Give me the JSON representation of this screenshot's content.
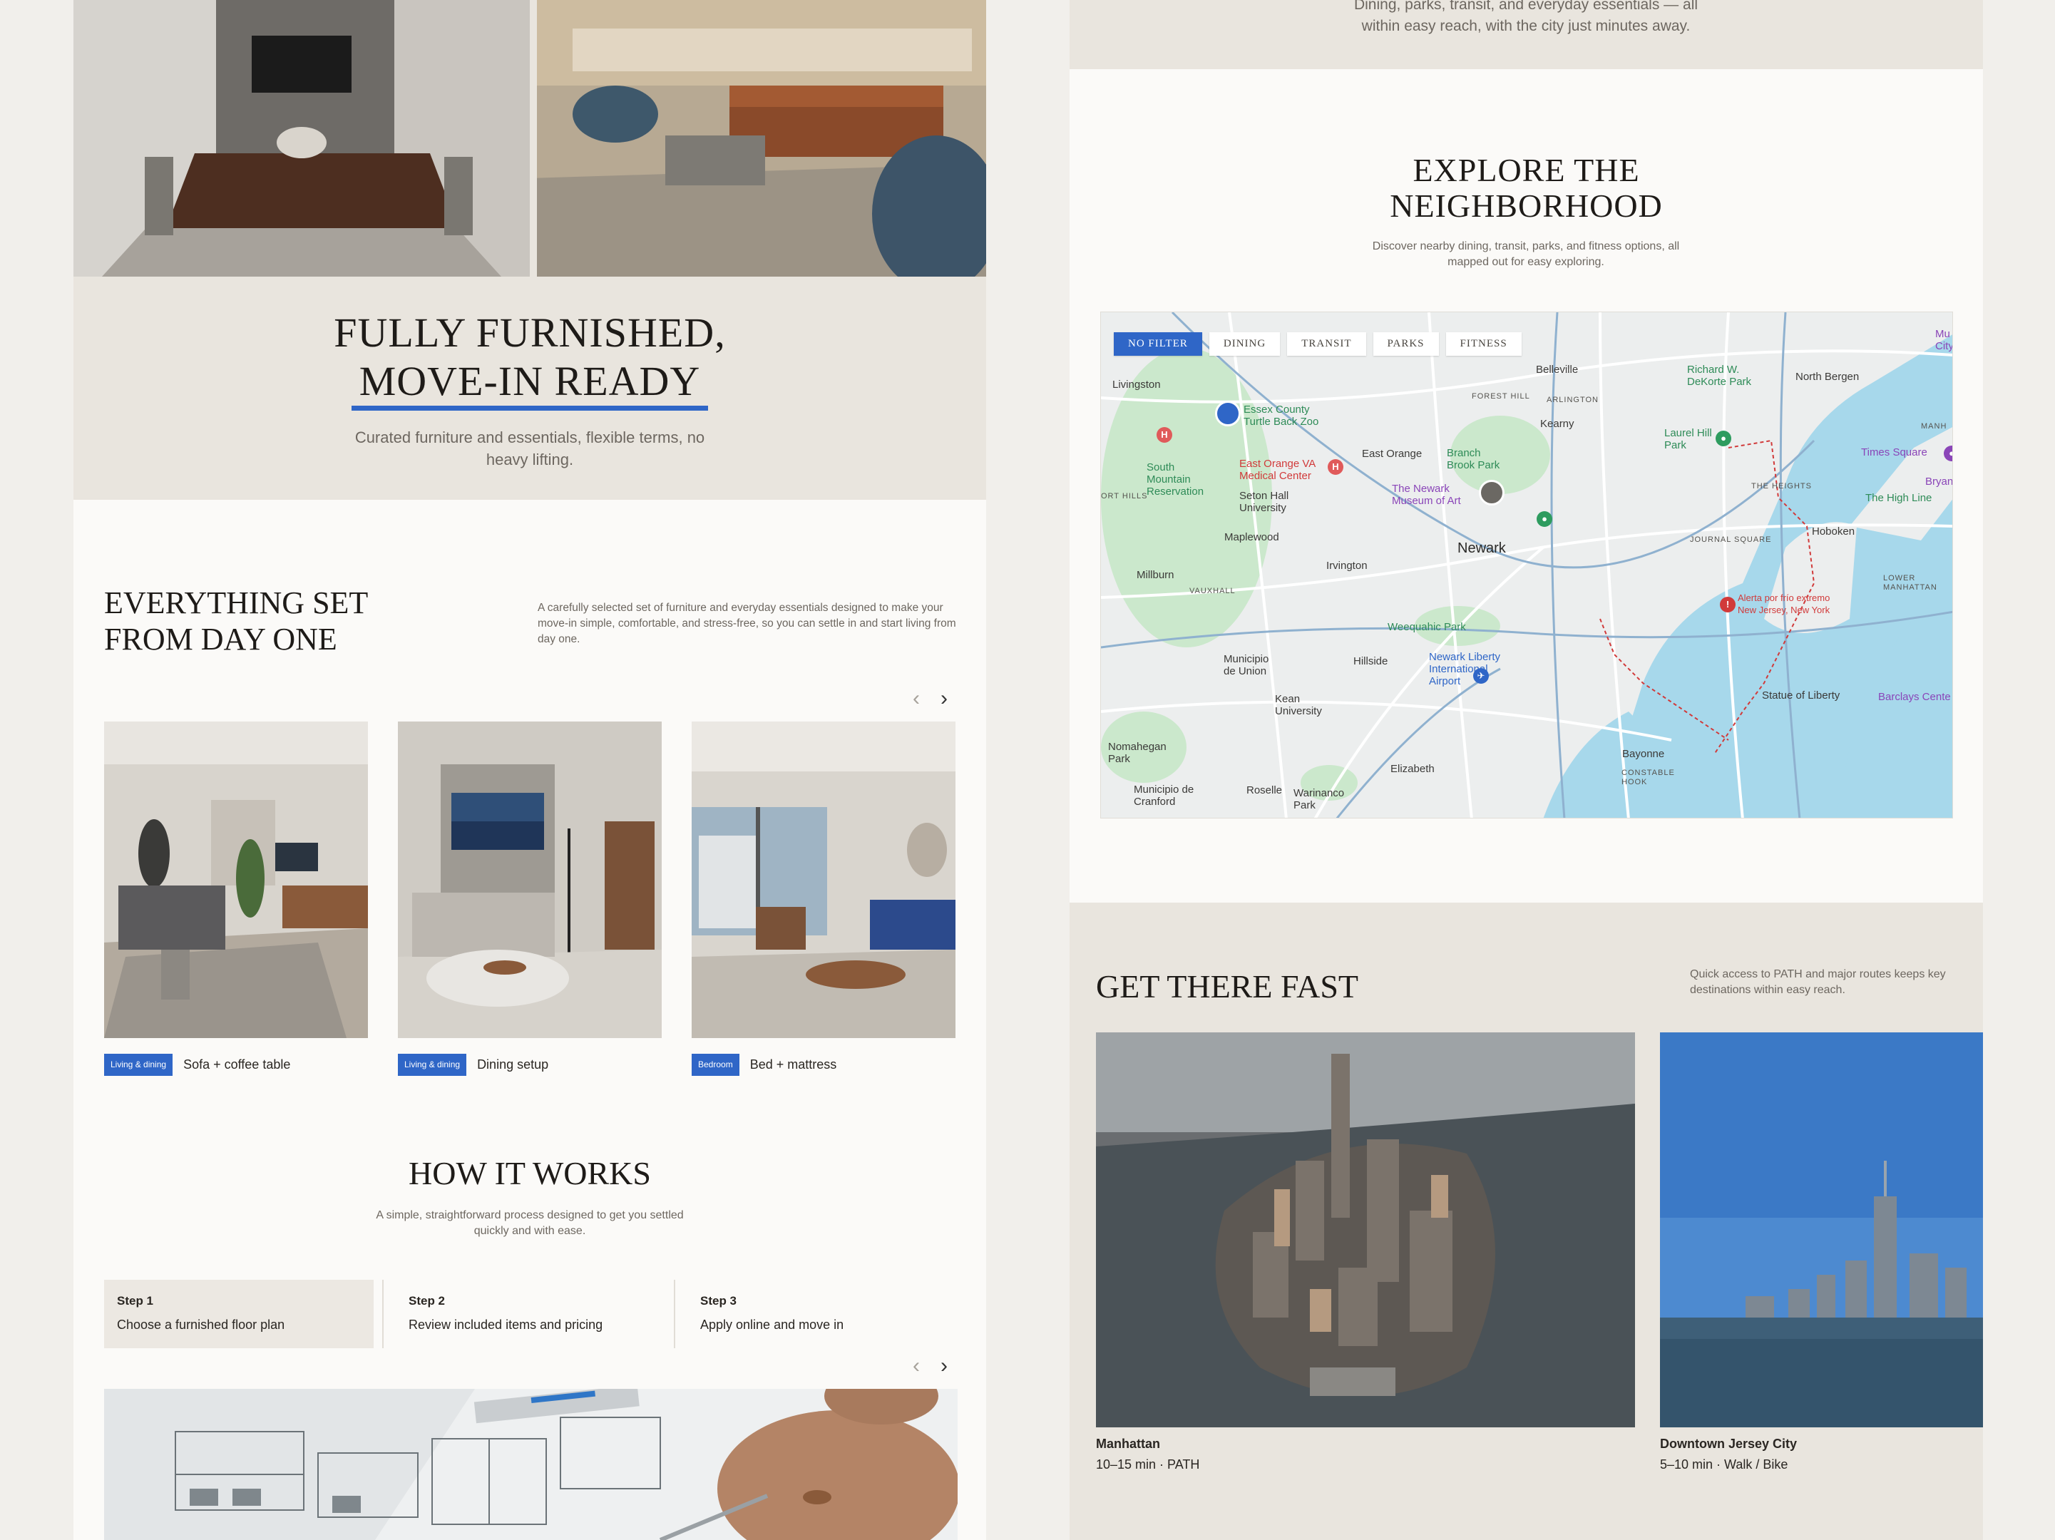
{
  "left": {
    "furnished": {
      "title_line1": "FULLY FURNISHED,",
      "title_line2": "MOVE-IN READY",
      "subtitle": "Curated furniture and essentials, flexible terms, no heavy lifting."
    },
    "everything": {
      "title": "EVERYTHING SET FROM DAY ONE",
      "description": "A carefully selected set of furniture and everyday essentials designed to make your move-in simple, comfortable, and stress-free, so you can settle in and start living from day one."
    },
    "carousel": {
      "prev_icon": "‹",
      "next_icon": "›"
    },
    "cards": [
      {
        "tag": "Living & dining",
        "label": "Sofa + coffee table"
      },
      {
        "tag": "Living & dining",
        "label": "Dining setup"
      },
      {
        "tag": "Bedroom",
        "label": "Bed + mattress"
      }
    ],
    "how": {
      "title": "HOW IT WORKS",
      "description": "A simple, straightforward process designed to get you settled quickly and with ease."
    },
    "steps": [
      {
        "num": "Step 1",
        "text": "Choose a furnished floor plan"
      },
      {
        "num": "Step 2",
        "text": "Review included items and pricing"
      },
      {
        "num": "Step 3",
        "text": "Apply online and move in"
      }
    ]
  },
  "right": {
    "dining_text": "Dining, parks, transit, and everyday essentials — all within easy reach, with the city just minutes away.",
    "explore": {
      "title_line1": "EXPLORE THE",
      "title_line2": "NEIGHBORHOOD",
      "description": "Discover nearby dining, transit, parks, and fitness options, all mapped out for easy exploring."
    },
    "map": {
      "filters": [
        "NO FILTER",
        "DINING",
        "TRANSIT",
        "PARKS",
        "FITNESS"
      ],
      "active_filter": "NO FILTER",
      "labels": {
        "newark": "Newark",
        "belleville": "Belleville",
        "livingston": "Livingston",
        "north_bergen": "North Bergen",
        "kearny": "Kearny",
        "east_orange": "East Orange",
        "maplewood": "Maplewood",
        "irvington": "Irvington",
        "millburn": "Millburn",
        "hillside": "Hillside",
        "hoboken": "Hoboken",
        "bayonne": "Bayonne",
        "elizabeth": "Elizabeth",
        "roselle": "Roselle",
        "union": "Municipio de Union",
        "cranford": "Municipio de Cranford",
        "kean": "Kean University",
        "nomahegan": "Nomahegan Park",
        "warinanco": "Warinanco Park",
        "weequahic": "Weequahic Park",
        "branch_brook": "Branch Brook Park",
        "south_mountain": "South Mountain Reservation",
        "seton_hall": "Seton Hall University",
        "essex_zoo": "Essex County Turtle Back Zoo",
        "va_center": "East Orange VA Medical Center",
        "newark_museum": "The Newark Museum of Art",
        "airport": "Newark Liberty International Airport",
        "statue": "Statue of Liberty",
        "laurel_hill": "Laurel Hill Park",
        "dekorte": "Richard W. DeKorte Park",
        "times_square": "Times Square",
        "high_line": "The High Line",
        "barclays": "Barclays Cente",
        "alert_title": "Alerta por frío extremo",
        "alert_sub": "New Jersey, New York",
        "forest_hill": "FOREST HILL",
        "arlington": "ARLINGTON",
        "vauxhall": "VAUXHALL",
        "journal_square": "JOURNAL SQUARE",
        "the_heights": "THE HEIGHTS",
        "lower_manhattan": "LOWER MANHATTAN",
        "constable_hook": "CONSTABLE HOOK",
        "manh": "MANH",
        "short_hills": "ORT HILLS",
        "mu_city": "Mu City",
        "bryan": "Bryan"
      }
    },
    "fast": {
      "title": "GET THERE FAST",
      "description": "Quick access to PATH and major routes keeps key destinations within easy reach."
    },
    "destinations": [
      {
        "name": "Manhattan",
        "time": "10–15 min · PATH"
      },
      {
        "name": "Downtown Jersey City",
        "time": "5–10 min · Walk / Bike"
      }
    ]
  },
  "colors": {
    "accent": "#2f66c7",
    "band": "#e9e5de",
    "page": "#fbfaf8",
    "background": "#f1efeb"
  }
}
